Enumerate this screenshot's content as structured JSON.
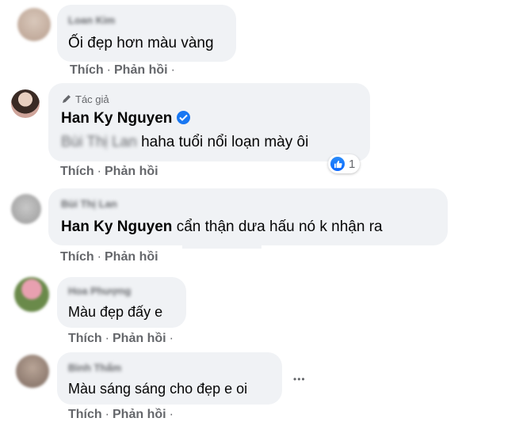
{
  "comments": [
    {
      "author": "Loan Kim",
      "text": "Ối đẹp hơn màu vàng",
      "actions": {
        "like": "Thích",
        "reply": "Phản hồi"
      }
    },
    {
      "author_tag": "Tác giả",
      "author": "Han Ky Nguyen",
      "mention": "Bùi Thị Lan",
      "text": "haha tuổi nổi loạn mày ôi",
      "reaction_count": "1",
      "actions": {
        "like": "Thích",
        "reply": "Phản hồi"
      }
    },
    {
      "author": "Bùi Thị Lan",
      "mention": "Han Ky Nguyen",
      "text": "cẩn thận dưa hấu nó k nhận ra",
      "actions": {
        "like": "Thích",
        "reply": "Phản hồi"
      }
    },
    {
      "author": "Hoa Phượng",
      "text": "Màu đẹp đấy e",
      "actions": {
        "like": "Thích",
        "reply": "Phản hồi"
      }
    },
    {
      "author": "Bình Thẩm",
      "text": "Màu sáng sáng cho đẹp e oi",
      "more": "•••",
      "actions": {
        "like": "Thích",
        "reply": "Phản hồi"
      }
    }
  ],
  "colors": {
    "bubble": "#f0f2f5",
    "secondary_text": "#65676b",
    "primary_text": "#050505",
    "accent_blue": "#1877f2"
  },
  "icons": [
    "pencil-icon",
    "verified-badge-icon",
    "like-reaction-icon",
    "more-options-icon"
  ]
}
